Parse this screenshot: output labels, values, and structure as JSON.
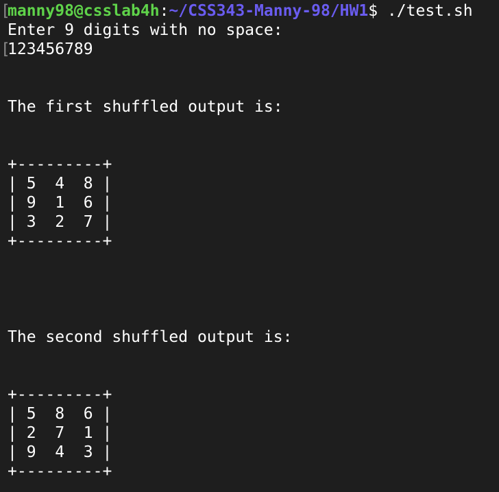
{
  "prompt": {
    "user_host": "manny98@csslab4h",
    "separator": ":",
    "path": "~/CSS343-Manny-98/HW1",
    "symbol": "$",
    "command": " ./test.sh"
  },
  "output": {
    "enter_prompt": "Enter 9 digits with no space:",
    "user_input": "123456789",
    "first_heading": "The first shuffled output is:",
    "first_grid": {
      "border_top": "+---------+",
      "rows": [
        "| 5  4  8 |",
        "| 9  1  6 |",
        "| 3  2  7 |"
      ],
      "border_bottom": "+---------+"
    },
    "second_heading": "The second shuffled output is:",
    "second_grid": {
      "border_top": "+---------+",
      "rows": [
        "| 5  8  6 |",
        "| 2  7  1 |",
        "| 9  4  3 |"
      ],
      "border_bottom": "+---------+"
    }
  },
  "colors": {
    "background": "#1e1e1e",
    "user_host": "#5fd34a",
    "path": "#6a5cf0",
    "text": "#ffffff",
    "bracket": "#8a8a8a"
  }
}
